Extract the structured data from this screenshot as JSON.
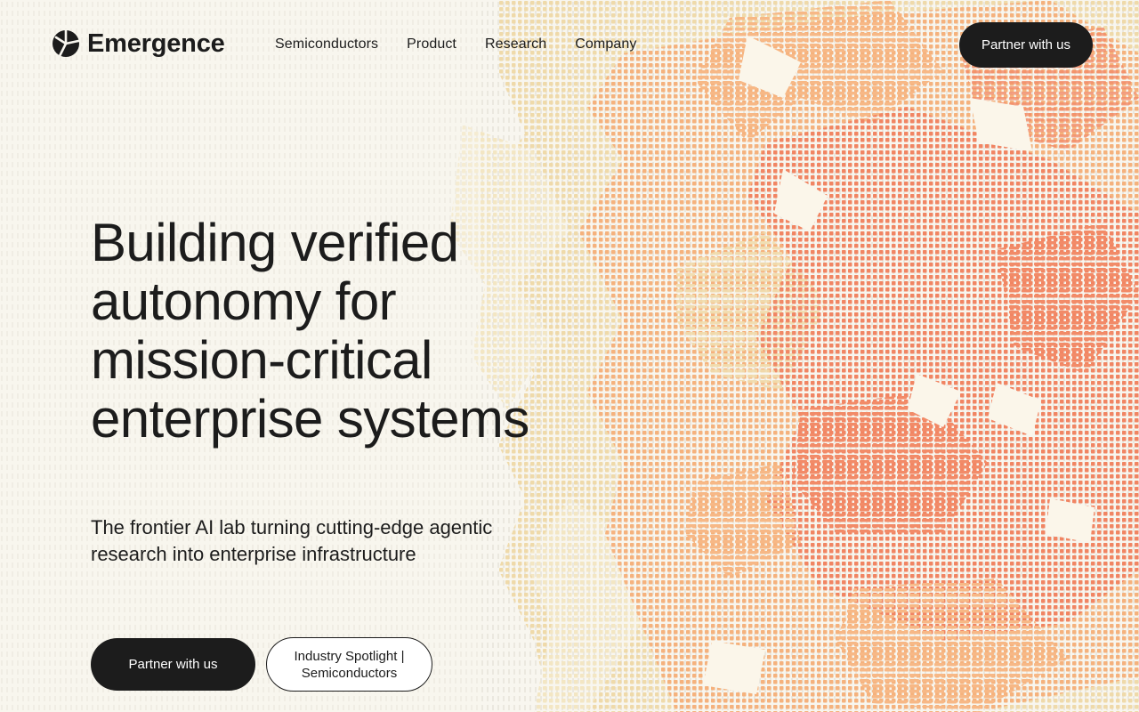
{
  "brand": {
    "name": "Emergence",
    "logo_icon": "emergence-logo-icon"
  },
  "nav": {
    "links": [
      "Semiconductors",
      "Product",
      "Research",
      "Company"
    ],
    "cta_label": "Partner with us"
  },
  "hero": {
    "title": "Building verified autonomy for mission-critical enterprise systems",
    "subtitle": "The frontier AI lab turning cutting-edge agentic research into enterprise infrastructure",
    "primary_cta": "Partner with us",
    "secondary_cta": "Industry Spotlight | Semiconductors"
  },
  "colors": {
    "background": "#f8f6ef",
    "text": "#1c1c1c",
    "button_dark": "#1c1c1c",
    "accent_coral": "#f07d5e",
    "accent_peach": "#f6ad78",
    "accent_sand": "#efd8a6"
  }
}
